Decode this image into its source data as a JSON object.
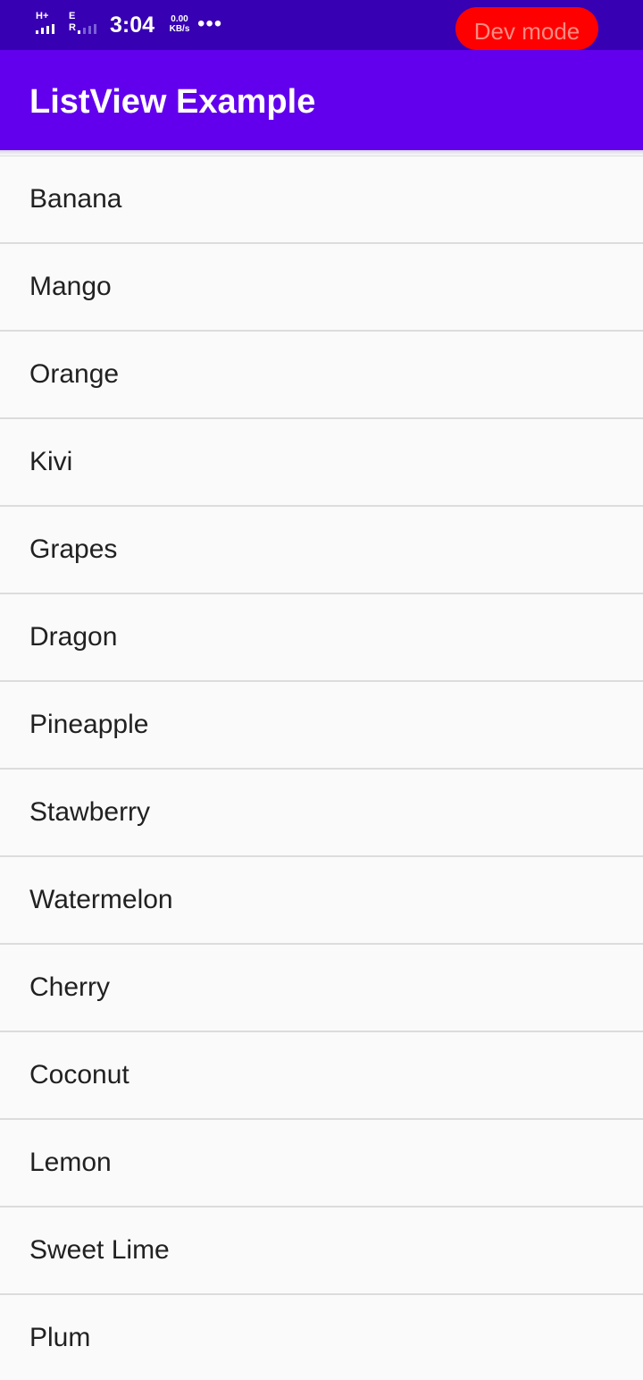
{
  "status_bar": {
    "net_top_label": "H+",
    "net_bottom_label": "E",
    "roaming_label": "R",
    "time": "3:04",
    "speed_value": "0.00",
    "speed_unit": "KB/s",
    "more_icon": "more-dots-icon",
    "dev_mode_label": "Dev mode",
    "colors": {
      "background": "#3700b3",
      "dev_badge": "#ff0000"
    }
  },
  "app_bar": {
    "title": "ListView Example",
    "color": "#6200ee"
  },
  "list": {
    "items": [
      "Banana",
      "Mango",
      "Orange",
      "Kivi",
      "Grapes",
      "Dragon",
      "Pineapple",
      "Stawberry",
      "Watermelon",
      "Cherry",
      "Coconut",
      "Lemon",
      "Sweet Lime",
      "Plum"
    ]
  }
}
